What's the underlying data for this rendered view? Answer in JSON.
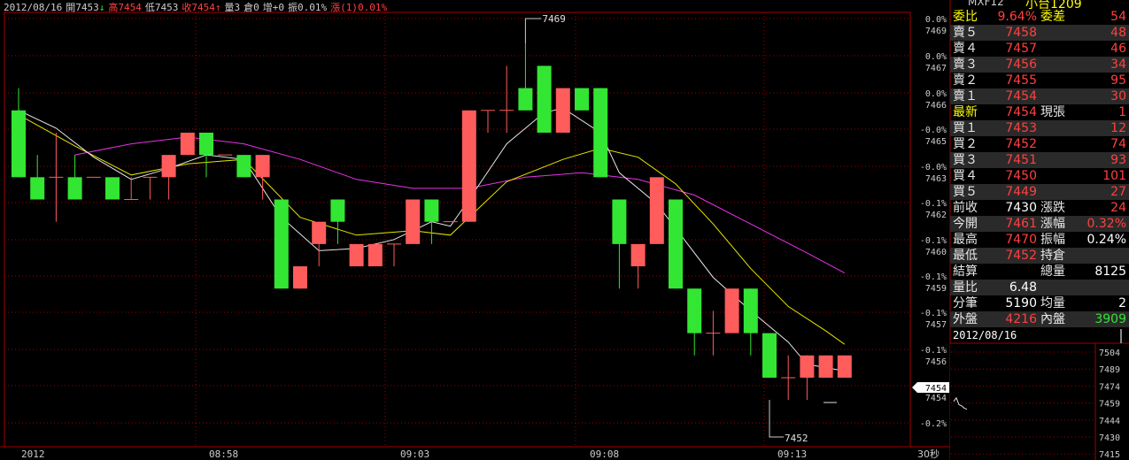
{
  "header": {
    "date": "2012/08/16",
    "open": "開7453",
    "open_arrow": "↓",
    "high": "高7454",
    "low": "低7453",
    "close": "收7454",
    "close_arrow": "↑",
    "volume": "量3",
    "open_interest": "倉0",
    "oi_change": "增+0",
    "amplitude": "振0.01%",
    "change": "漲(1)0.01%"
  },
  "quote": {
    "symbol": "MXF12",
    "name": "小台1209",
    "rows": [
      {
        "l1": "委比",
        "v1": "9.64%",
        "l2": "委差",
        "v2": "54"
      },
      {
        "l1": "賣５",
        "v1": "7458",
        "l2": "",
        "v2": "48"
      },
      {
        "l1": "賣４",
        "v1": "7457",
        "l2": "",
        "v2": "46"
      },
      {
        "l1": "賣３",
        "v1": "7456",
        "l2": "",
        "v2": "34"
      },
      {
        "l1": "賣２",
        "v1": "7455",
        "l2": "",
        "v2": "95"
      },
      {
        "l1": "賣１",
        "v1": "7454",
        "l2": "",
        "v2": "30"
      },
      {
        "l1": "最新",
        "v1": "7454",
        "l2": "現張",
        "v2": "1"
      },
      {
        "l1": "買１",
        "v1": "7453",
        "l2": "",
        "v2": "12"
      },
      {
        "l1": "買２",
        "v1": "7452",
        "l2": "",
        "v2": "74"
      },
      {
        "l1": "買３",
        "v1": "7451",
        "l2": "",
        "v2": "93"
      },
      {
        "l1": "買４",
        "v1": "7450",
        "l2": "",
        "v2": "101"
      },
      {
        "l1": "買５",
        "v1": "7449",
        "l2": "",
        "v2": "27"
      },
      {
        "l1": "前收",
        "v1": "7430",
        "l2": "漲跌",
        "v2": "24"
      },
      {
        "l1": "今開",
        "v1": "7461",
        "l2": "漲幅",
        "v2": "0.32%"
      },
      {
        "l1": "最高",
        "v1": "7470",
        "l2": "振幅",
        "v2": "0.24%"
      },
      {
        "l1": "最低",
        "v1": "7452",
        "l2": "持倉",
        "v2": ""
      },
      {
        "l1": "結算",
        "v1": "",
        "l2": "總量",
        "v2": "8125"
      },
      {
        "l1": "量比",
        "v1": "6.48",
        "l2": "",
        "v2": ""
      },
      {
        "l1": "分筆",
        "v1": "5190",
        "l2": "均量",
        "v2": "2"
      },
      {
        "l1": "外盤",
        "v1": "4216",
        "l2": "內盤",
        "v2": "3909"
      }
    ],
    "mini_date": "2012/08/16"
  },
  "colors": {
    "up": "#ff5c5c",
    "down": "#33e633",
    "ma_short": "#e6e6e6",
    "ma_mid": "#e6e600",
    "ma_long": "#e633e6",
    "grid": "#a00000",
    "axis_text": "#cccccc",
    "label_yellow": "#ffff00",
    "label_red": "#ff4040",
    "label_green": "#33e633"
  },
  "chart_data": {
    "type": "candlestick",
    "interval": "30秒",
    "x_ticks": [
      "2012",
      "08:58",
      "09:03",
      "09:08",
      "09:13"
    ],
    "y_right_labels": [
      {
        "pct": "0.0%",
        "price": "7469"
      },
      {
        "pct": "0.0%",
        "price": "7467"
      },
      {
        "pct": "0.0%",
        "price": "7466"
      },
      {
        "pct": "-0.0%",
        "price": "7465"
      },
      {
        "pct": "-0.0%",
        "price": "7463"
      },
      {
        "pct": "-0.1%",
        "price": "7462"
      },
      {
        "pct": "-0.1%",
        "price": "7460"
      },
      {
        "pct": "-0.1%",
        "price": "7459"
      },
      {
        "pct": "-0.1%",
        "price": "7457"
      },
      {
        "pct": "-0.1%",
        "price": "7456"
      },
      {
        "pct": "-0.1%",
        "price": "7454"
      },
      {
        "pct": "-0.2%",
        "price": ""
      }
    ],
    "ylim": [
      7450.9,
      7470.4
    ],
    "high_annotation": "7469",
    "low_annotation": "7452",
    "current_price_tag": "7454",
    "candles": [
      {
        "o": 7466,
        "h": 7467,
        "c": 7463,
        "l": 7463
      },
      {
        "o": 7463,
        "h": 7464,
        "c": 7462,
        "l": 7462
      },
      {
        "o": 7463,
        "h": 7465,
        "c": 7463,
        "l": 7461
      },
      {
        "o": 7463,
        "h": 7464,
        "c": 7462,
        "l": 7462
      },
      {
        "o": 7463,
        "h": 7463,
        "c": 7463,
        "l": 7463
      },
      {
        "o": 7463,
        "h": 7463,
        "c": 7462,
        "l": 7462
      },
      {
        "o": 7462,
        "h": 7463,
        "c": 7462,
        "l": 7462
      },
      {
        "o": 7463,
        "h": 7463,
        "c": 7463,
        "l": 7462
      },
      {
        "o": 7463,
        "h": 7464,
        "c": 7464,
        "l": 7462
      },
      {
        "o": 7464,
        "h": 7465,
        "c": 7465,
        "l": 7464
      },
      {
        "o": 7465,
        "h": 7465,
        "c": 7464,
        "l": 7463
      },
      {
        "o": 7464,
        "h": 7464,
        "c": 7464,
        "l": 7464
      },
      {
        "o": 7464,
        "h": 7464,
        "c": 7463,
        "l": 7463
      },
      {
        "o": 7463,
        "h": 7464,
        "c": 7464,
        "l": 7462
      },
      {
        "o": 7462,
        "h": 7462,
        "c": 7458,
        "l": 7458
      },
      {
        "o": 7458,
        "h": 7459,
        "c": 7459,
        "l": 7458
      },
      {
        "o": 7460,
        "h": 7461,
        "c": 7461,
        "l": 7459
      },
      {
        "o": 7462,
        "h": 7462,
        "c": 7461,
        "l": 7460
      },
      {
        "o": 7459,
        "h": 7460,
        "c": 7460,
        "l": 7459
      },
      {
        "o": 7459,
        "h": 7459,
        "c": 7460,
        "l": 7459
      },
      {
        "o": 7460,
        "h": 7460,
        "c": 7460,
        "l": 7459
      },
      {
        "o": 7460,
        "h": 7460,
        "c": 7462,
        "l": 7460
      },
      {
        "o": 7462,
        "h": 7462,
        "c": 7461,
        "l": 7460
      },
      {
        "o": 7461,
        "h": 7461,
        "c": 7461,
        "l": 7461
      },
      {
        "o": 7461,
        "h": 7462,
        "c": 7466,
        "l": 7461
      },
      {
        "o": 7466,
        "h": 7466,
        "c": 7466,
        "l": 7465
      },
      {
        "o": 7466,
        "h": 7468,
        "c": 7466,
        "l": 7465
      },
      {
        "o": 7467,
        "h": 7469,
        "c": 7466,
        "l": 7466
      },
      {
        "o": 7468,
        "h": 7468,
        "c": 7465,
        "l": 7465
      },
      {
        "o": 7465,
        "h": 7465,
        "c": 7467,
        "l": 7465
      },
      {
        "o": 7467,
        "h": 7467,
        "c": 7466,
        "l": 7466
      },
      {
        "o": 7467,
        "h": 7467,
        "c": 7463,
        "l": 7463
      },
      {
        "o": 7462,
        "h": 7462,
        "c": 7460,
        "l": 7458
      },
      {
        "o": 7459,
        "h": 7459,
        "c": 7460,
        "l": 7458
      },
      {
        "o": 7460,
        "h": 7463,
        "c": 7463,
        "l": 7460
      },
      {
        "o": 7462,
        "h": 7462,
        "c": 7458,
        "l": 7458
      },
      {
        "o": 7458,
        "h": 7458,
        "c": 7456,
        "l": 7455
      },
      {
        "o": 7456,
        "h": 7457,
        "c": 7456,
        "l": 7455
      },
      {
        "o": 7456,
        "h": 7456,
        "c": 7458,
        "l": 7456
      },
      {
        "o": 7458,
        "h": 7458,
        "c": 7456,
        "l": 7455
      },
      {
        "o": 7456,
        "h": 7456,
        "c": 7454,
        "l": 7454
      },
      {
        "o": 7454,
        "h": 7455,
        "c": 7454,
        "l": 7453
      },
      {
        "o": 7454,
        "h": 7455,
        "c": 7455,
        "l": 7453
      },
      {
        "o": 7454,
        "h": 7455,
        "c": 7455,
        "l": 7454
      },
      {
        "o": 7454,
        "h": 7455,
        "c": 7455,
        "l": 7454
      }
    ],
    "ma_short": [
      [
        0,
        7466.0
      ],
      [
        2,
        7465.2
      ],
      [
        4,
        7463.9
      ],
      [
        6,
        7462.9
      ],
      [
        8,
        7463.4
      ],
      [
        10,
        7464.0
      ],
      [
        12,
        7463.8
      ],
      [
        14,
        7461.2
      ],
      [
        16,
        7459.7
      ],
      [
        18,
        7459.8
      ],
      [
        20,
        7460.2
      ],
      [
        22,
        7461.0
      ],
      [
        23,
        7460.8
      ],
      [
        24,
        7462.0
      ],
      [
        26,
        7464.5
      ],
      [
        28,
        7465.9
      ],
      [
        29,
        7466.1
      ],
      [
        31,
        7465.0
      ],
      [
        32,
        7463.2
      ],
      [
        34,
        7461.8
      ],
      [
        35,
        7460.7
      ],
      [
        37,
        7458.5
      ],
      [
        39,
        7457.0
      ],
      [
        41,
        7455.6
      ],
      [
        42,
        7454.6
      ],
      [
        44,
        7454.3
      ]
    ],
    "ma_mid": [
      [
        0,
        7465.8
      ],
      [
        3,
        7464.4
      ],
      [
        6,
        7463.1
      ],
      [
        9,
        7463.6
      ],
      [
        12,
        7463.8
      ],
      [
        15,
        7461.2
      ],
      [
        18,
        7460.4
      ],
      [
        21,
        7460.6
      ],
      [
        23,
        7460.4
      ],
      [
        26,
        7462.8
      ],
      [
        29,
        7463.8
      ],
      [
        31,
        7464.3
      ],
      [
        33,
        7463.9
      ],
      [
        35,
        7462.7
      ],
      [
        37,
        7460.9
      ],
      [
        39,
        7458.9
      ],
      [
        41,
        7457.2
      ],
      [
        43,
        7456.1
      ],
      [
        44,
        7455.5
      ]
    ],
    "ma_long": [
      [
        3,
        7464.0
      ],
      [
        6,
        7464.5
      ],
      [
        9,
        7464.8
      ],
      [
        12,
        7464.5
      ],
      [
        15,
        7463.8
      ],
      [
        18,
        7462.9
      ],
      [
        21,
        7462.5
      ],
      [
        24,
        7462.5
      ],
      [
        27,
        7463.0
      ],
      [
        30,
        7463.2
      ],
      [
        33,
        7462.9
      ],
      [
        36,
        7462.2
      ],
      [
        39,
        7460.9
      ],
      [
        42,
        7459.6
      ],
      [
        44,
        7458.7
      ]
    ],
    "mini_chart": {
      "y_ticks": [
        "7504",
        "7489",
        "7474",
        "7459",
        "7444",
        "7430",
        "7415"
      ],
      "points": [
        7461,
        7464,
        7458,
        7457,
        7455,
        7454
      ]
    }
  }
}
